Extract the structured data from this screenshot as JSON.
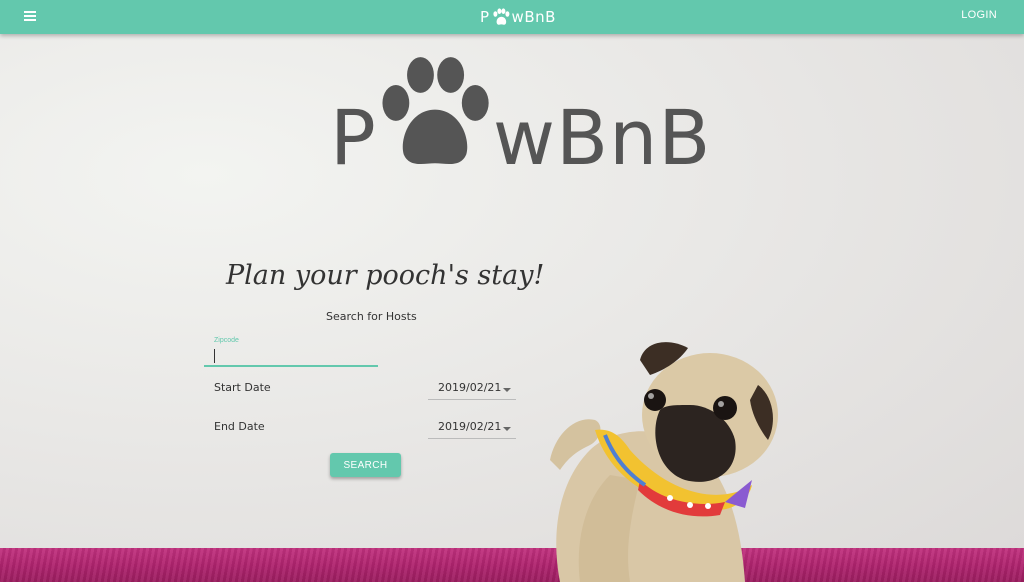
{
  "nav": {
    "menu_icon": "menu-icon",
    "brand": {
      "prefix": "P",
      "suffix": "wBnB",
      "paw_icon": "paw-icon"
    },
    "login_label": "LOGIN"
  },
  "logo": {
    "prefix": "P",
    "suffix": "wBnB",
    "paw_icon": "paw-icon"
  },
  "hero": {
    "tagline": "Plan your pooch's stay!",
    "subtitle": "Search for Hosts"
  },
  "form": {
    "zipcode_label": "Zipcode",
    "zipcode_value": "",
    "start_date_label": "Start Date",
    "start_date_value": "2019/02/21",
    "end_date_label": "End Date",
    "end_date_value": "2019/02/21",
    "search_label": "SEARCH"
  },
  "colors": {
    "accent": "#63c8ad",
    "logo_gray": "#555555",
    "bedspread": "#b0246f"
  }
}
